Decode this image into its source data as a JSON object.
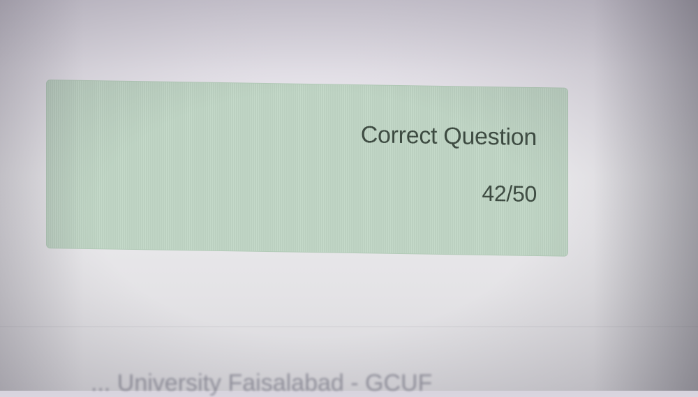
{
  "result_card": {
    "label": "Correct Question",
    "value": "42/50",
    "background_color": "#c1d7c6"
  },
  "footer": {
    "text": "... University Faisalabad - GCUF"
  }
}
